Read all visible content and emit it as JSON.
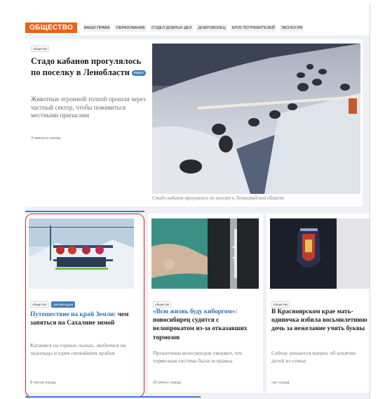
{
  "section": {
    "badge": "ОБЩЕСТВО",
    "links": [
      "ВАШИ ПРАВА",
      "ОБРАЗОВАНИЕ",
      "ОТДЕЛ ДОБРЫХ ДЕЛ",
      "ДОБРОВОЛЕЦ",
      "КЛУБ ПОТРЕБИТЕЛЕЙ",
      "ЭКОЛОГИЯ"
    ]
  },
  "main": {
    "tag": "общество",
    "title": "Стадо кабанов прогулялось по поселку в Ленобласти",
    "video_label": "видео",
    "lead": "Животные огромной толпой прошли через частный сектор, чтобы поживиться местными припасами",
    "time": "3 минуты назад",
    "caption": "Стадо кабанов прогулялось по поселку в Ленинградской области"
  },
  "cards": [
    {
      "tags": [
        "общество",
        "рекомендуем"
      ],
      "title_link": "Путешествие на край Земли:",
      "title_rest": " чем заняться на Сахалине зимой",
      "lead": "Катаемся на горных лыжах, любуемся на ледопады и едим свежайших крабов",
      "time": "8 часов назад"
    },
    {
      "tags": [
        "общество"
      ],
      "title_link": "«Всю жизнь буду киборгом»:",
      "title_rest": " новосибирец судится с велопрокатом из-за отказавших тормозов",
      "lead": "Прокатчики велосипедов уверяют, что тормозная система была исправна",
      "time": "20 минут назад"
    },
    {
      "tags": [
        "общество"
      ],
      "title_link": "",
      "title_rest": "В Красноярском крае мать-одиночка избила восьмилетнюю дочь за нежелание учить буквы",
      "lead": "Сейчас решается вопрос об изъятии детей из семьи",
      "time": "час назад"
    }
  ],
  "colors": {
    "accent": "#e9631b",
    "link": "#2f6fb5",
    "tag_blue": "#3d7fc4",
    "highlight": "#d92323"
  }
}
